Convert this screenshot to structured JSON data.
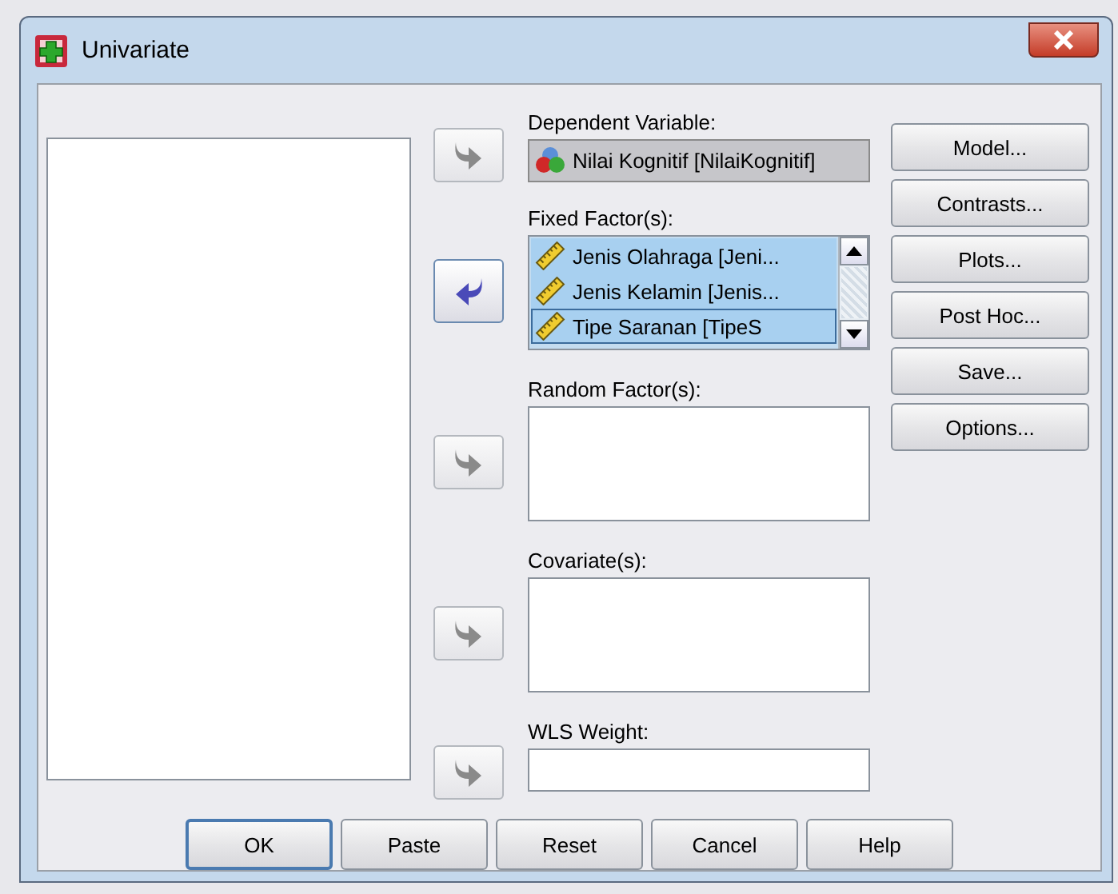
{
  "window": {
    "title": "Univariate"
  },
  "sections": [
    {
      "kind": "single",
      "label": "Dependent Variable:",
      "arrow": {
        "kind": "right",
        "enabled": false
      },
      "items": [
        {
          "name": "Nilai Kognitif [NilaiKognitif]",
          "kind": "nominal",
          "selected": false
        }
      ]
    },
    {
      "kind": "list",
      "label": "Fixed Factor(s):",
      "arrow": {
        "kind": "left",
        "enabled": true
      },
      "scrollbar": true,
      "items": [
        {
          "name": "Jenis Olahraga [Jeni...",
          "kind": "scale",
          "selected": true,
          "focused": false
        },
        {
          "name": "Jenis Kelamin [Jenis...",
          "kind": "scale",
          "selected": true,
          "focused": false
        },
        {
          "name": "Tipe Saranan [TipeS",
          "kind": "scale",
          "selected": true,
          "focused": true
        }
      ]
    },
    {
      "kind": "list",
      "label": "Random Factor(s):",
      "arrow": {
        "kind": "right",
        "enabled": false
      }
    },
    {
      "kind": "list",
      "label": "Covariate(s):",
      "arrow": {
        "kind": "right",
        "enabled": false
      }
    },
    {
      "kind": "field",
      "label": "WLS Weight:",
      "arrow": {
        "kind": "right",
        "enabled": false
      }
    }
  ],
  "side_buttons": [
    "Model...",
    "Contrasts...",
    "Plots...",
    "Post Hoc...",
    "Save...",
    "Options..."
  ],
  "bottom_buttons": [
    {
      "label": "OK",
      "default": true
    },
    {
      "label": "Paste",
      "default": false
    },
    {
      "label": "Reset",
      "default": false
    },
    {
      "label": "Cancel",
      "default": false
    },
    {
      "label": "Help",
      "default": false
    }
  ]
}
